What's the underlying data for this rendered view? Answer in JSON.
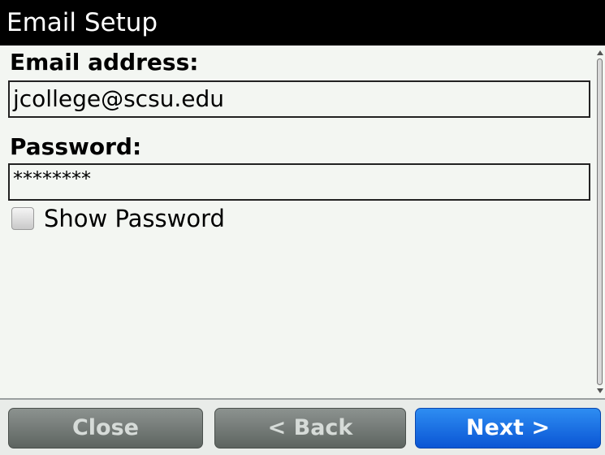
{
  "window": {
    "title": "Email Setup"
  },
  "form": {
    "email_label": "Email address:",
    "email_value": "jcollege@scsu.edu",
    "password_label": "Password:",
    "password_value": "********",
    "show_password_label": "Show Password",
    "show_password_checked": false
  },
  "buttons": {
    "close": "Close",
    "back": "< Back",
    "next": "Next >"
  },
  "colors": {
    "titlebar_bg": "#000000",
    "background": "#f3f6f2",
    "primary_button": "#0a55d4",
    "secondary_button": "#5d6460"
  }
}
